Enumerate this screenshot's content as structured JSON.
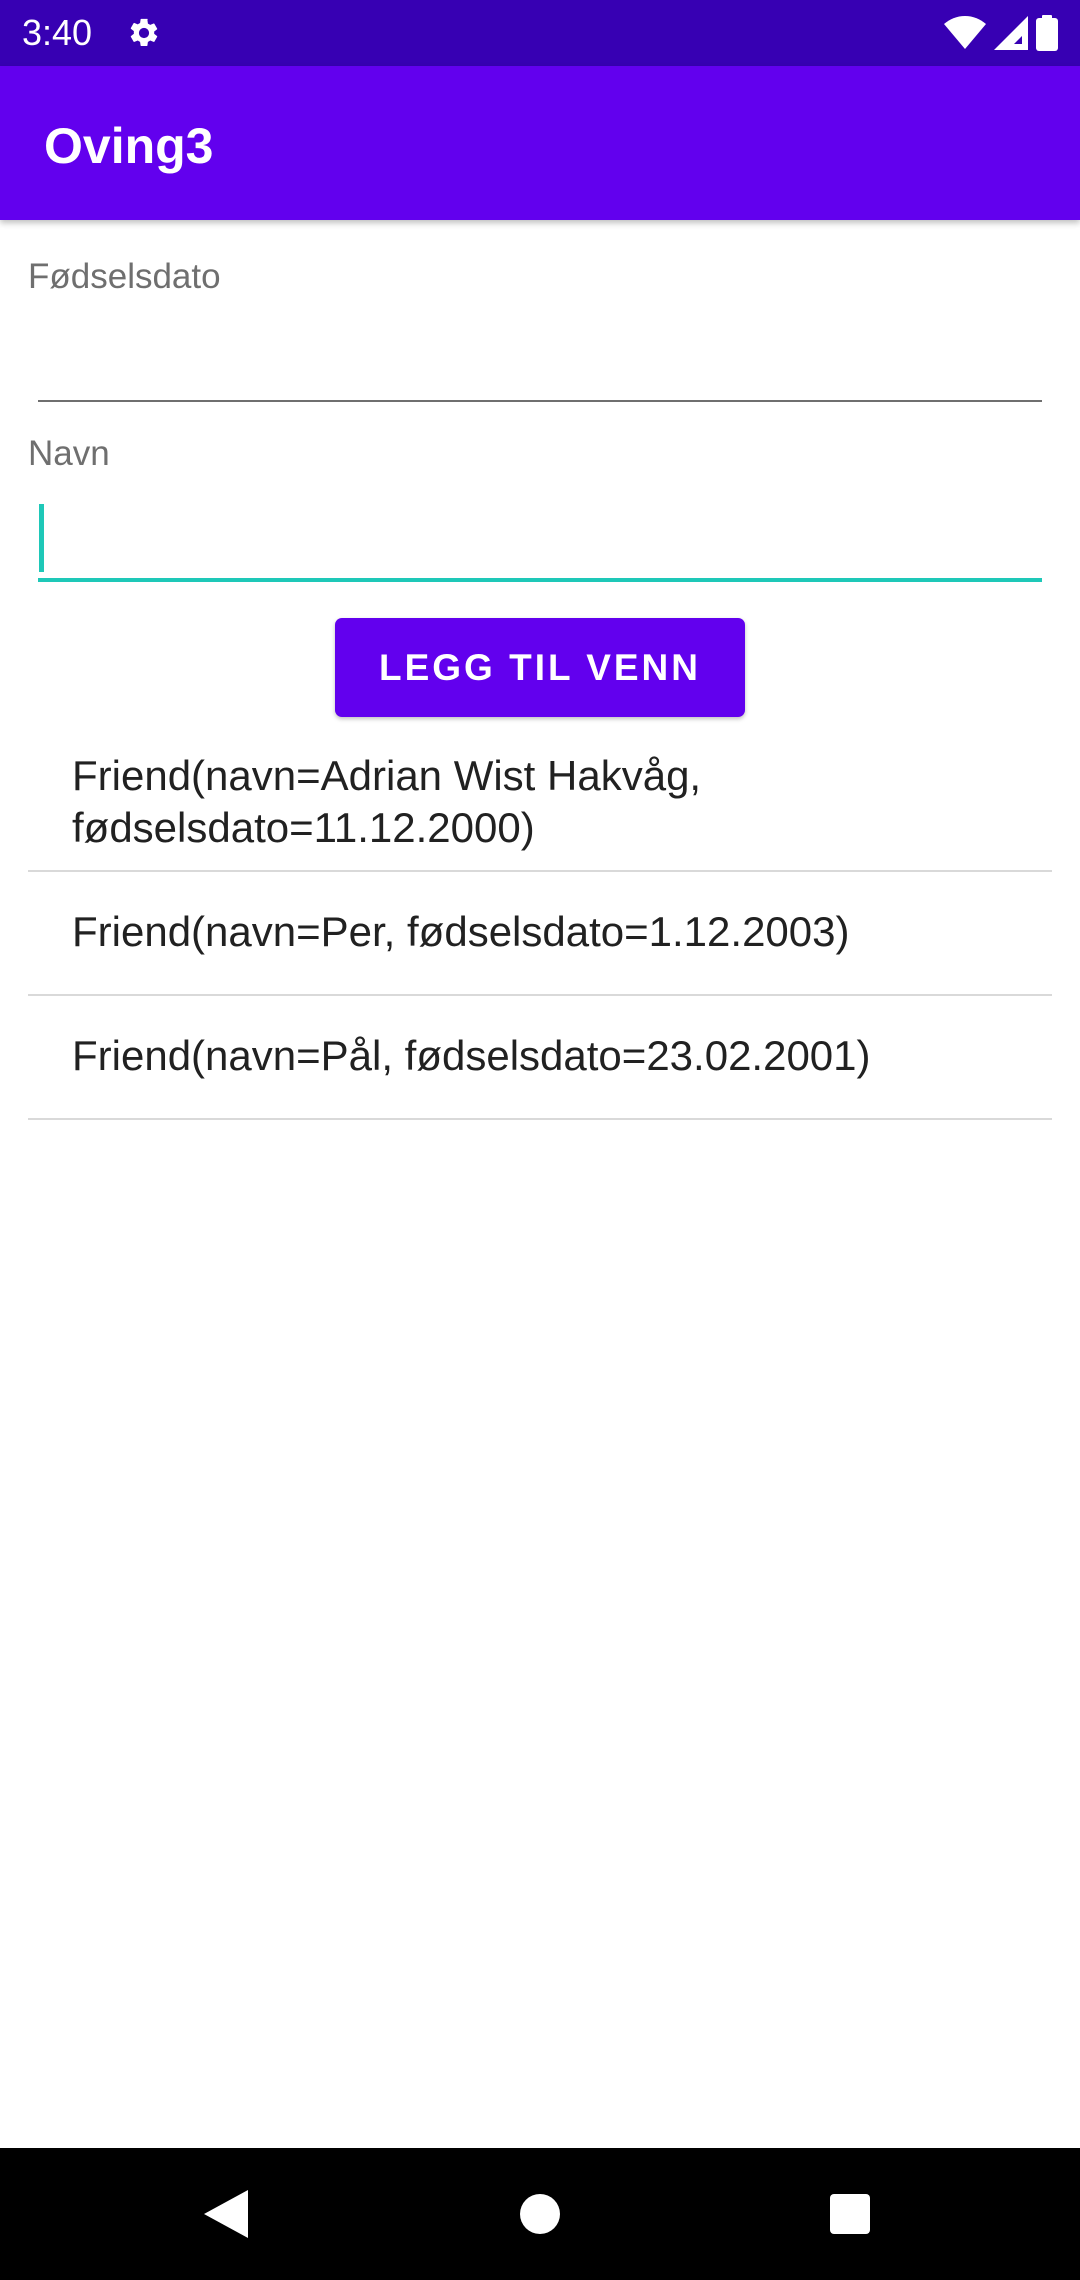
{
  "status_bar": {
    "time": "3:40",
    "icons": [
      "gear-icon",
      "wifi-icon",
      "signal-icon",
      "battery-icon"
    ]
  },
  "app_bar": {
    "title": "Oving3"
  },
  "form": {
    "birthdate_label": "Fødselsdato",
    "birthdate_value": "",
    "name_label": "Navn",
    "name_value": "",
    "add_button_label": "LEGG TIL VENN"
  },
  "friends": [
    {
      "line1": "Friend(navn=Adrian Wist Hakvåg,",
      "line2": "fødselsdato=11.12.2000)"
    },
    {
      "text": "Friend(navn=Per, fødselsdato=1.12.2003)"
    },
    {
      "text": "Friend(navn=Pål, fødselsdato=23.02.2001)"
    }
  ],
  "nav_bar": {
    "icons": [
      "back-icon",
      "home-icon",
      "recents-icon"
    ]
  },
  "colors": {
    "status_bar": "#3700b3",
    "primary": "#6200ee",
    "accent": "#1ec8b8"
  }
}
